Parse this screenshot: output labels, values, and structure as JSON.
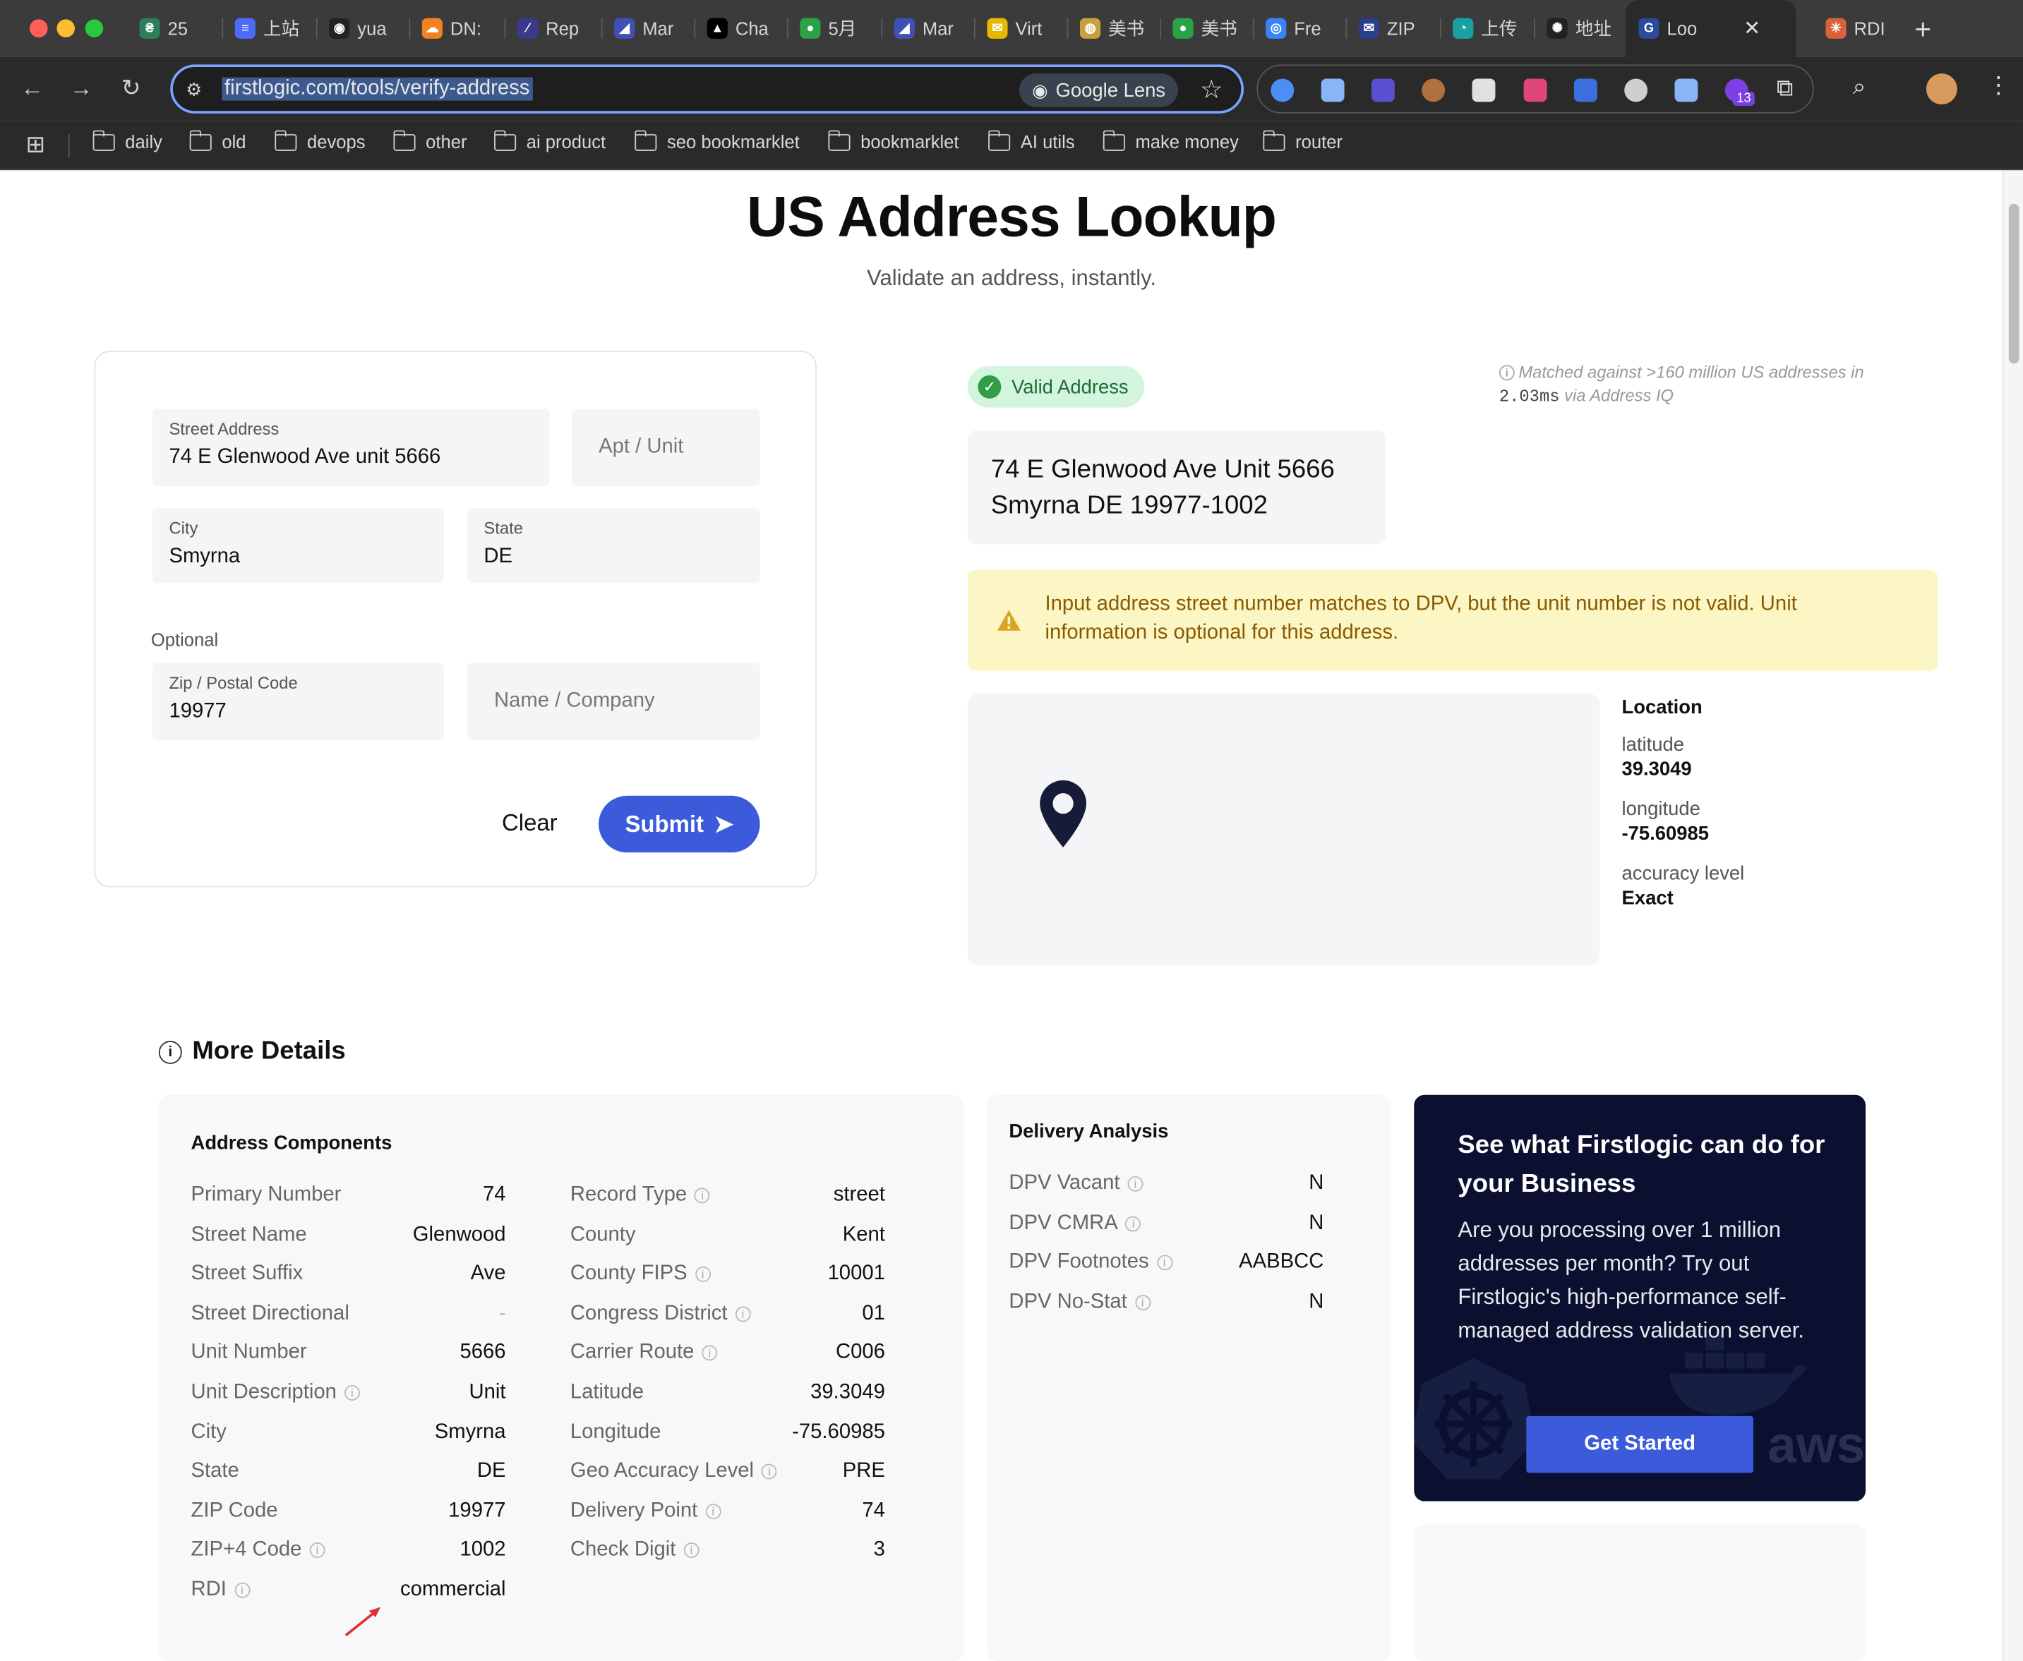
{
  "browser": {
    "tabs": [
      {
        "label": "25",
        "color": "#2e7d5b",
        "glyph": "₴"
      },
      {
        "label": "上站",
        "color": "#4a6cf7",
        "glyph": "≡"
      },
      {
        "label": "yua",
        "color": "#222222",
        "glyph": "◉"
      },
      {
        "label": "DN:",
        "color": "#f48120",
        "glyph": "☁"
      },
      {
        "label": "Rep",
        "color": "#3a3a8a",
        "glyph": "∕"
      },
      {
        "label": "Mar",
        "color": "#3f51b5",
        "glyph": "◢"
      },
      {
        "label": "Cha",
        "color": "#000000",
        "glyph": "▲"
      },
      {
        "label": "5月",
        "color": "#2ba245",
        "glyph": "●"
      },
      {
        "label": "Mar",
        "color": "#3f51b5",
        "glyph": "◢"
      },
      {
        "label": "Virt",
        "color": "#e6b800",
        "glyph": "✉"
      },
      {
        "label": "美书",
        "color": "#c9a040",
        "glyph": "◍"
      },
      {
        "label": "美书",
        "color": "#2ba245",
        "glyph": "●"
      },
      {
        "label": "Fre",
        "color": "#3b82f6",
        "glyph": "◎"
      },
      {
        "label": "ZIP",
        "color": "#2c3e8f",
        "glyph": "✉"
      },
      {
        "label": "上传",
        "color": "#19a0a0",
        "glyph": "◔"
      },
      {
        "label": "地址",
        "color": "#222222",
        "glyph": "✺"
      },
      {
        "label": "Loo",
        "color": "#2a4a9a",
        "glyph": "G"
      },
      {
        "label": "RDI",
        "color": "#d9623b",
        "glyph": "✳"
      }
    ],
    "active_tab_index": 16,
    "new_tab": "+",
    "url": "firstlogic.com/tools/verify-address",
    "google_lens": "Google Lens",
    "extension_badge": "13",
    "bookmarks": [
      "daily",
      "old",
      "devops",
      "other",
      "ai product",
      "seo bookmarklet",
      "bookmarklet",
      "AI utils",
      "make money",
      "router"
    ]
  },
  "page": {
    "title": "US Address Lookup",
    "subtitle": "Validate an address, instantly."
  },
  "form": {
    "street_label": "Street Address",
    "street_value": "74 E Glenwood Ave unit 5666",
    "apt_placeholder": "Apt / Unit",
    "city_label": "City",
    "city_value": "Smyrna",
    "state_label": "State",
    "state_value": "DE",
    "optional_label": "Optional",
    "zip_label": "Zip / Postal Code",
    "zip_value": "19977",
    "name_placeholder": "Name / Company",
    "clear_label": "Clear",
    "submit_label": "Submit"
  },
  "result": {
    "badge": "Valid Address",
    "matched_pre": "Matched against >160 million US addresses in",
    "matched_time": "2.03ms",
    "matched_post": "via Address IQ",
    "address_line1": "74 E Glenwood Ave Unit 5666",
    "address_line2": "Smyrna DE 19977-1002",
    "warning": "Input address street number matches to DPV, but the unit number is not valid. Unit information is optional for this address.",
    "location": {
      "heading": "Location",
      "lat_label": "latitude",
      "lat": "39.3049",
      "lng_label": "longitude",
      "lng": "-75.60985",
      "acc_label": "accuracy level",
      "acc": "Exact"
    }
  },
  "details": {
    "heading": "More Details",
    "components_title": "Address Components",
    "left_rows": [
      {
        "k": "Primary Number",
        "v": "74",
        "info": false
      },
      {
        "k": "Street Name",
        "v": "Glenwood",
        "info": false
      },
      {
        "k": "Street Suffix",
        "v": "Ave",
        "info": false
      },
      {
        "k": "Street Directional",
        "v": "-",
        "info": false
      },
      {
        "k": "Unit Number",
        "v": "5666",
        "info": false
      },
      {
        "k": "Unit Description",
        "v": "Unit",
        "info": true
      },
      {
        "k": "City",
        "v": "Smyrna",
        "info": false
      },
      {
        "k": "State",
        "v": "DE",
        "info": false
      },
      {
        "k": "ZIP Code",
        "v": "19977",
        "info": false
      },
      {
        "k": "ZIP+4 Code",
        "v": "1002",
        "info": true
      },
      {
        "k": "RDI",
        "v": "commercial",
        "info": true
      }
    ],
    "right_rows": [
      {
        "k": "Record Type",
        "v": "street",
        "info": true
      },
      {
        "k": "County",
        "v": "Kent",
        "info": false
      },
      {
        "k": "County FIPS",
        "v": "10001",
        "info": true
      },
      {
        "k": "Congress District",
        "v": "01",
        "info": true
      },
      {
        "k": "Carrier Route",
        "v": "C006",
        "info": true
      },
      {
        "k": "Latitude",
        "v": "39.3049",
        "info": false
      },
      {
        "k": "Longitude",
        "v": "-75.60985",
        "info": false
      },
      {
        "k": "Geo Accuracy Level",
        "v": "PRE",
        "info": true
      },
      {
        "k": "Delivery Point",
        "v": "74",
        "info": true
      },
      {
        "k": "Check Digit",
        "v": "3",
        "info": true
      }
    ],
    "delivery_title": "Delivery Analysis",
    "delivery_rows": [
      {
        "k": "DPV Vacant",
        "v": "N",
        "info": true
      },
      {
        "k": "DPV CMRA",
        "v": "N",
        "info": true
      },
      {
        "k": "DPV Footnotes",
        "v": "AABBCC",
        "info": true
      },
      {
        "k": "DPV No-Stat",
        "v": "N",
        "info": true
      }
    ]
  },
  "promo": {
    "heading": "See what Firstlogic can do for your Business",
    "body": "Are you processing over 1 million addresses per month? Try out Firstlogic's high-performance self-managed address validation server.",
    "cta": "Get Started",
    "aws": "aws"
  },
  "colors": {
    "accent": "#3b5bdb",
    "valid_bg": "#d3f4dd",
    "warning_bg": "#fbf6c4",
    "promo_bg": "#0b1030"
  }
}
